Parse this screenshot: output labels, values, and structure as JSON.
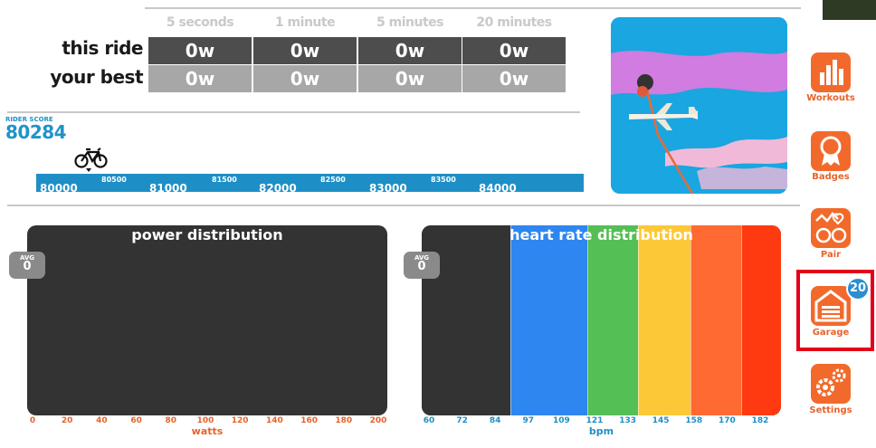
{
  "power_table": {
    "columns": [
      "5 seconds",
      "1 minute",
      "5 minutes",
      "20 minutes"
    ],
    "rows": [
      {
        "label": "this ride",
        "values": [
          "0w",
          "0w",
          "0w",
          "0w"
        ]
      },
      {
        "label": "your best",
        "values": [
          "0w",
          "0w",
          "0w",
          "0w"
        ]
      }
    ]
  },
  "rider_score": {
    "label": "RIDER SCORE",
    "value": "80284",
    "ticks_major": [
      "80000",
      "81000",
      "82000",
      "83000",
      "84000"
    ],
    "ticks_minor": [
      "80500",
      "81500",
      "82500",
      "83500"
    ]
  },
  "sidebar": {
    "items": [
      {
        "label": "Workouts",
        "icon": "bar-chart-icon"
      },
      {
        "label": "Badges",
        "icon": "ribbon-badge-icon"
      },
      {
        "label": "Pair",
        "icon": "pair-sensors-icon"
      },
      {
        "label": "Garage",
        "icon": "garage-icon",
        "badge": "20"
      },
      {
        "label": "Settings",
        "icon": "gears-icon"
      }
    ]
  },
  "power_distribution": {
    "title": "power distribution",
    "avg_label": "AVG",
    "avg_value": "0",
    "ticks": [
      "0",
      "20",
      "40",
      "60",
      "80",
      "100",
      "120",
      "140",
      "160",
      "180",
      "200"
    ],
    "unit": "watts"
  },
  "hr_distribution": {
    "title": "heart rate distribution",
    "avg_label": "AVG",
    "avg_value": "0",
    "ticks": [
      "60",
      "72",
      "84",
      "97",
      "109",
      "121",
      "133",
      "145",
      "158",
      "170",
      "182"
    ],
    "unit": "bpm",
    "zone_colors": [
      "#333333",
      "#2e86f0",
      "#54bf54",
      "#fdc838",
      "#ff6a33",
      "#ff3a10"
    ]
  },
  "colors": {
    "accent_orange": "#f26a2b",
    "score_blue": "#1e8fc6",
    "highlight_red": "#e3001b"
  }
}
